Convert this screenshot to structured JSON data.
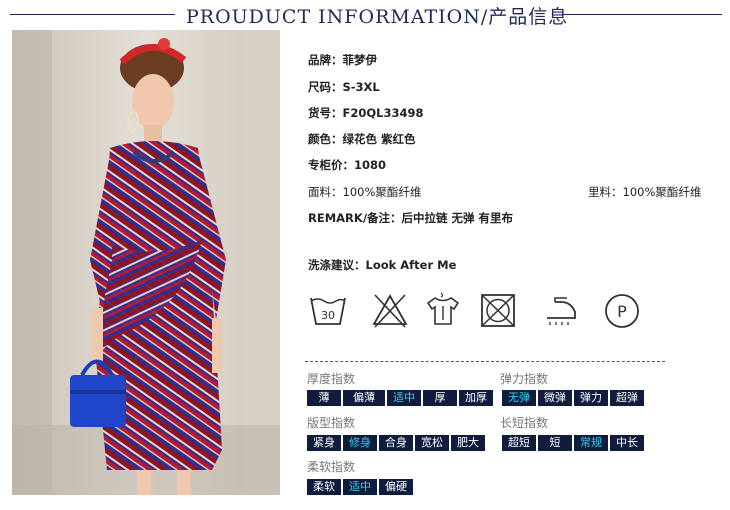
{
  "header": {
    "title": "PROUDUCT INFORMATION/产品信息"
  },
  "info": {
    "brand": "品牌：菲梦伊",
    "size": "尺码：S-3XL",
    "item_no": "货号：F20QL33498",
    "color": "颜色：绿花色 紫红色",
    "price": "专柜价：1080",
    "fabric": "面料：100%聚酯纤维",
    "lining": "里料：100%聚酯纤维",
    "remark": "REMARK/备注：后中拉链 无弹 有里布",
    "wash_label": "洗涤建议：",
    "wash_value": "Look After Me"
  },
  "care_icons": [
    "wash-30-icon",
    "no-bleach-icon",
    "shirt-dry-icon",
    "no-tumble-dry-icon",
    "iron-icon",
    "dry-clean-p-icon"
  ],
  "care_text": {
    "wash_temp": "30",
    "dry_clean": "P"
  },
  "indices": {
    "thickness": {
      "title": "厚度指数",
      "options": [
        "薄",
        "偏薄",
        "适中",
        "厚",
        "加厚"
      ],
      "selected": "适中"
    },
    "elasticity": {
      "title": "弹力指数",
      "options": [
        "无弹",
        "微弹",
        "弹力",
        "超弹"
      ],
      "selected": "无弹"
    },
    "fit": {
      "title": "版型指数",
      "options": [
        "紧身",
        "修身",
        "合身",
        "宽松",
        "肥大"
      ],
      "selected": "修身"
    },
    "length": {
      "title": "长短指数",
      "options": [
        "超短",
        "短",
        "常规",
        "中长"
      ],
      "selected": "常规"
    },
    "softness": {
      "title": "柔软指数",
      "options": [
        "柔软",
        "适中",
        "偏硬"
      ],
      "selected": "适中"
    }
  },
  "colors": {
    "navy": "#0f1c3e",
    "highlight": "#2fd0f0",
    "title": "#1e2a55"
  }
}
